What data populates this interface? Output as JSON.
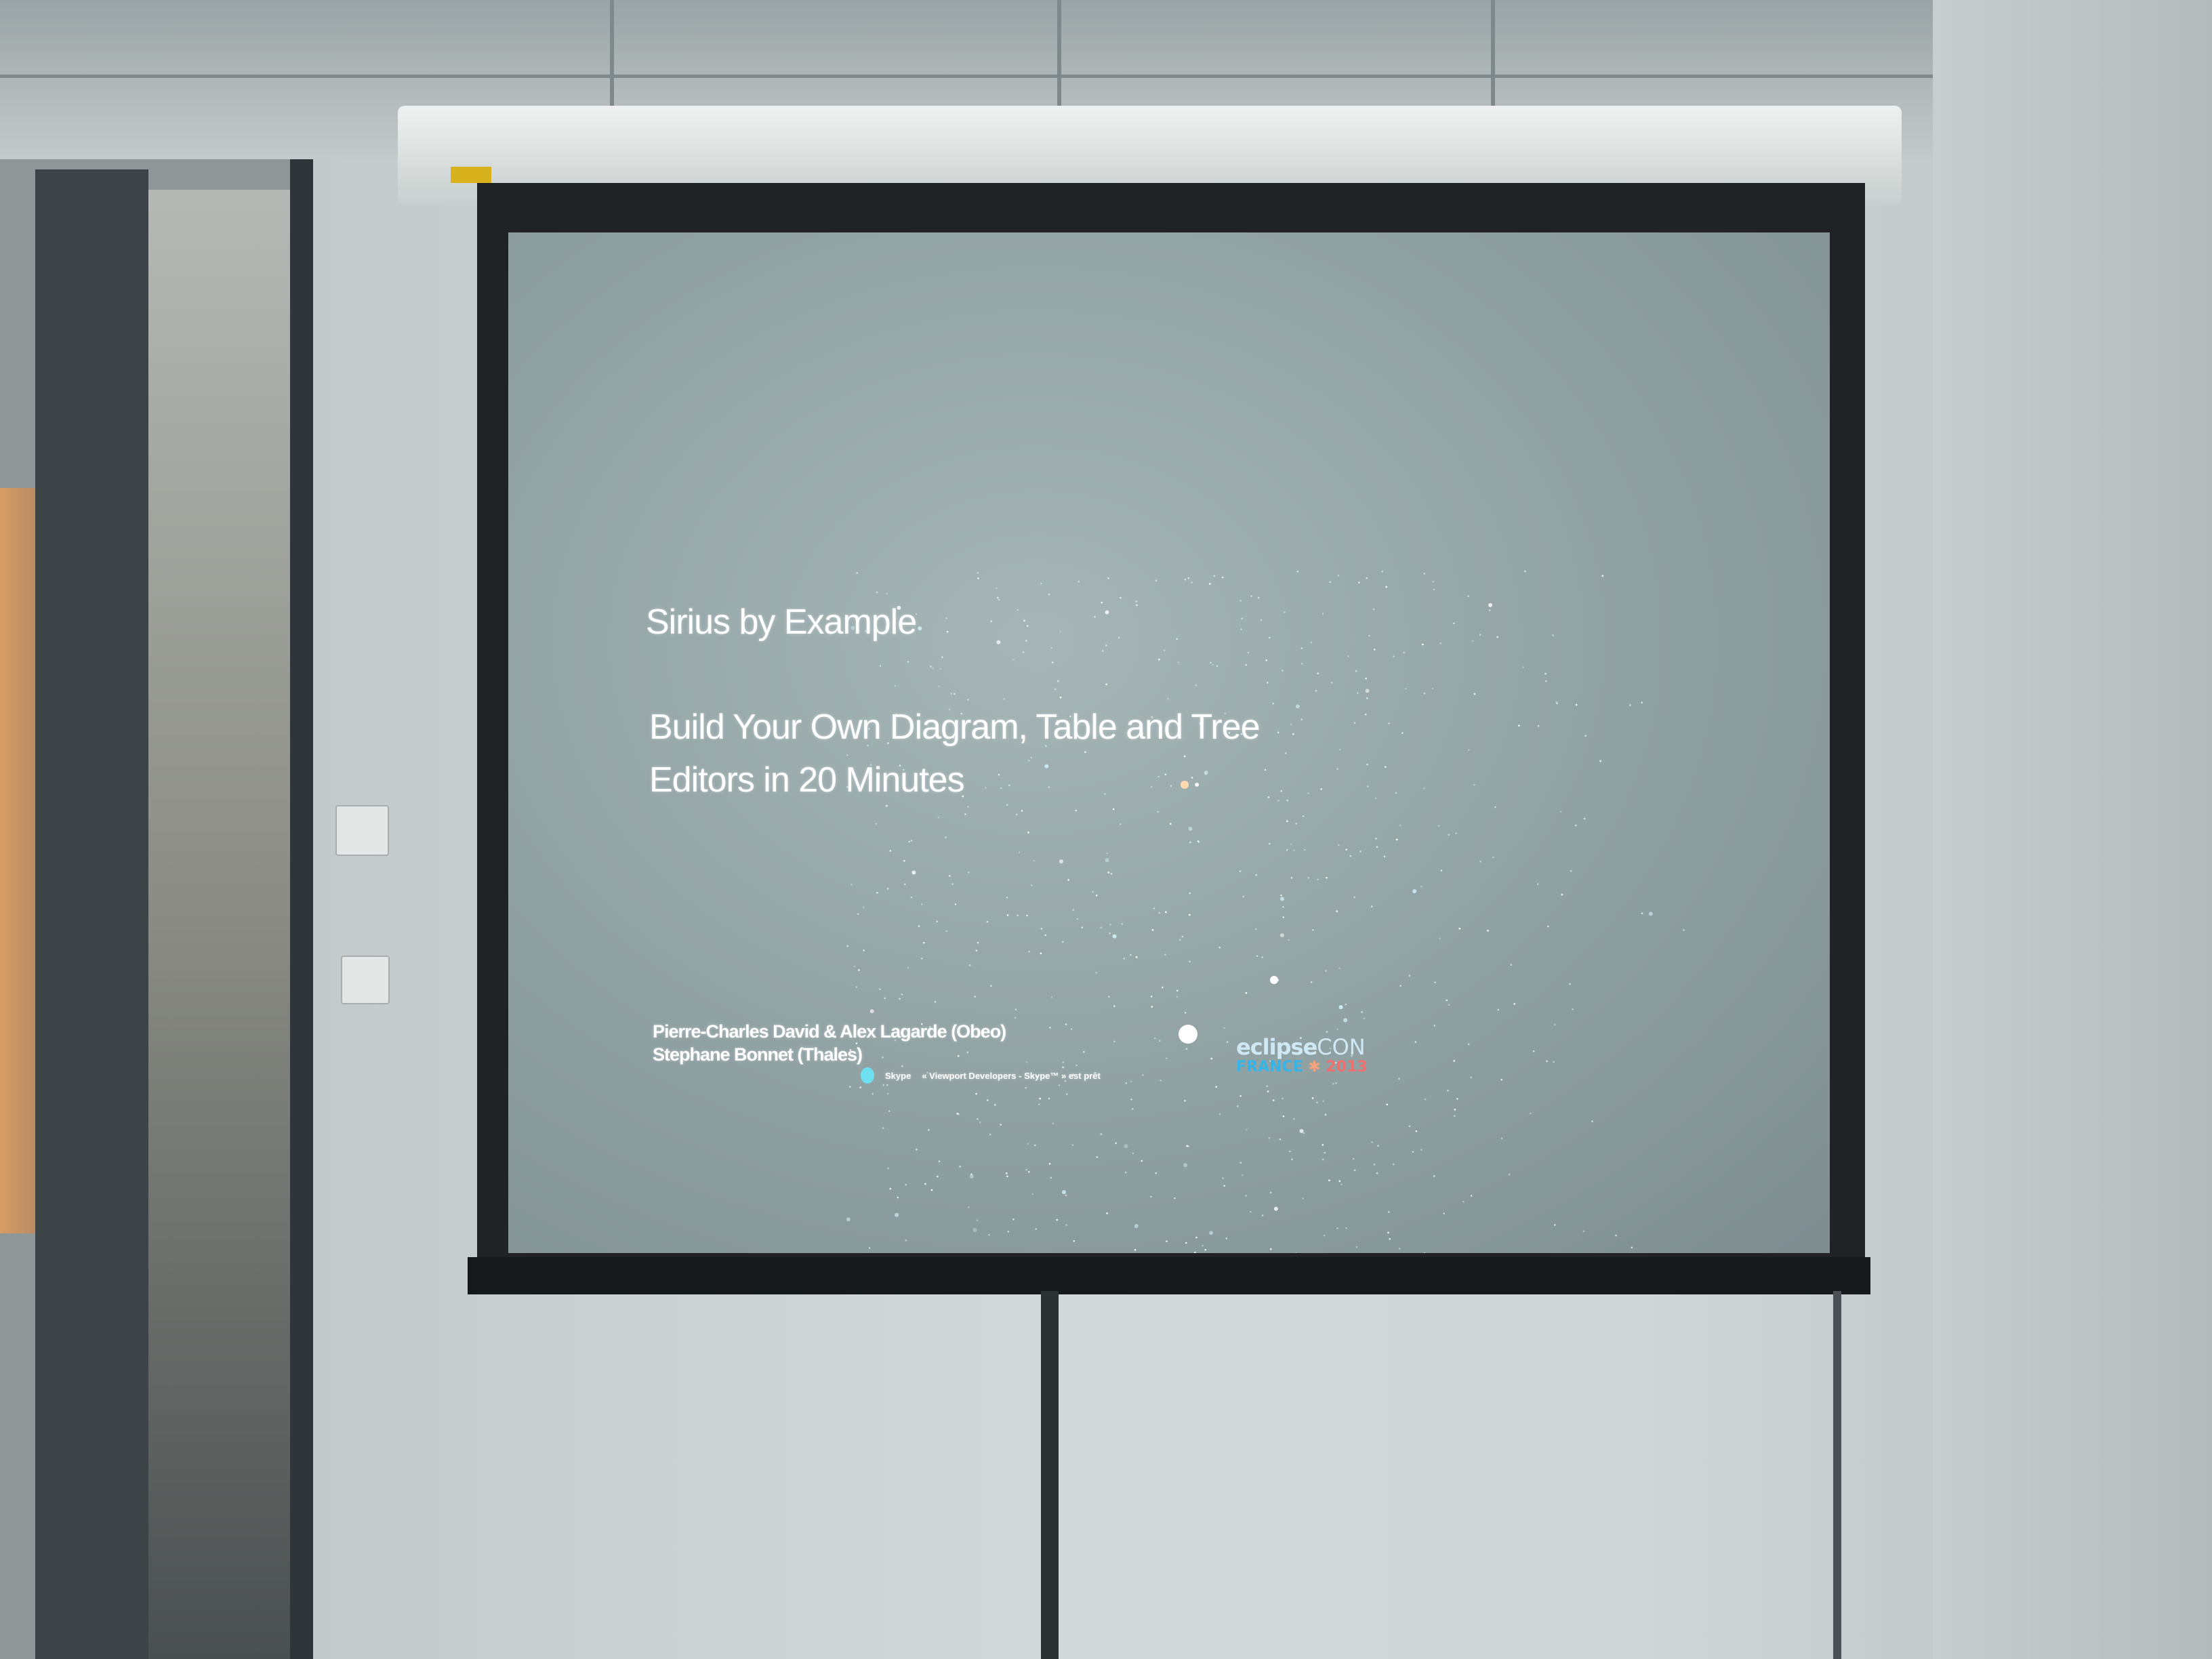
{
  "slide": {
    "title": "Sirius by Example",
    "subtitle_line1": "Build Your Own Diagram, Table and Tree",
    "subtitle_line2": "Editors in 20 Minutes",
    "authors_line1": "Pierre-Charles David & Alex Lagarde (Obeo)",
    "authors_line2": "Stephane Bonnet (Thales)",
    "logo": {
      "eclipse": "eclipse",
      "con": "CON",
      "france": "FRANCE",
      "year": "2013"
    },
    "notification": {
      "app": "Skype",
      "message": "« Viewport Developers - Skype™ » est prêt"
    }
  },
  "colors": {
    "logo_light": "#cfe9f4",
    "logo_france": "#35b4e8",
    "logo_year": "#f07070",
    "logo_star": "#f2a27c"
  }
}
